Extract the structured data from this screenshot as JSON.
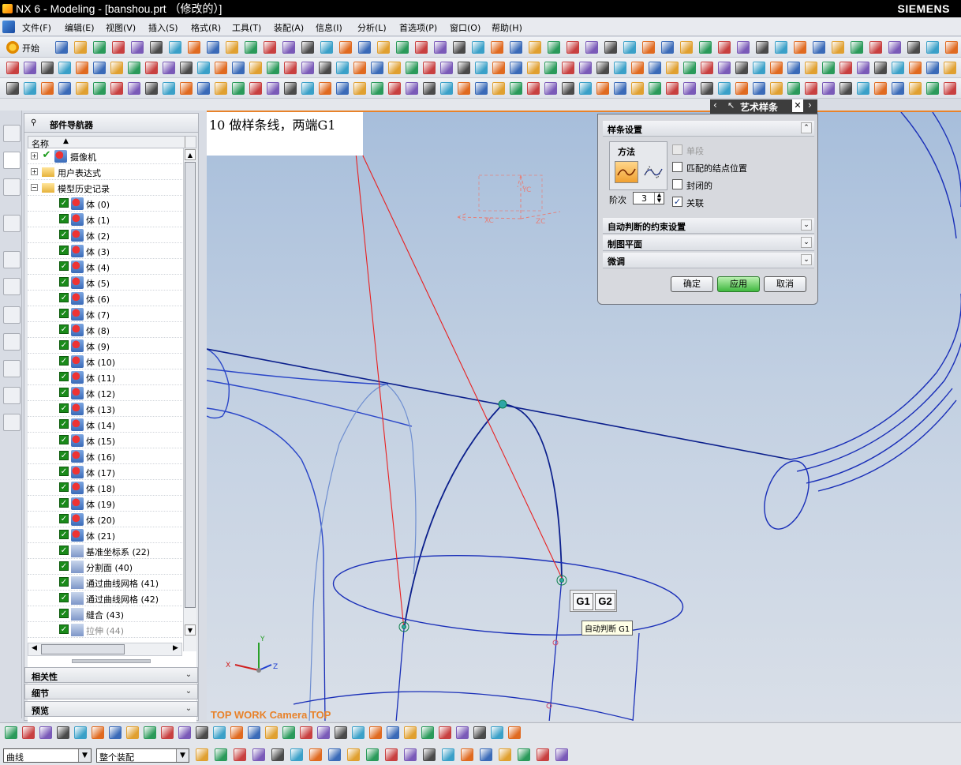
{
  "window": {
    "title": "NX 6 - Modeling - [banshou.prt （修改的）]",
    "brand": "SIEMENS"
  },
  "menu": [
    "文件(F)",
    "编辑(E)",
    "视图(V)",
    "插入(S)",
    "格式(R)",
    "工具(T)",
    "装配(A)",
    "信息(I)",
    "分析(L)",
    "首选项(P)",
    "窗口(O)",
    "帮助(H)"
  ],
  "toolbar": {
    "start_label": "开始"
  },
  "navigator": {
    "title": "部件导航器",
    "column_name": "名称",
    "top_items": [
      {
        "label": "摄像机",
        "expand": "+"
      },
      {
        "label": "用户表达式",
        "expand": "+"
      },
      {
        "label": "模型历史记录",
        "expand": "−"
      }
    ],
    "history_items": [
      {
        "label": "体 (0)"
      },
      {
        "label": "体 (1)"
      },
      {
        "label": "体 (2)"
      },
      {
        "label": "体 (3)"
      },
      {
        "label": "体 (4)"
      },
      {
        "label": "体 (5)"
      },
      {
        "label": "体 (6)"
      },
      {
        "label": "体 (7)"
      },
      {
        "label": "体 (8)"
      },
      {
        "label": "体 (9)"
      },
      {
        "label": "体 (10)"
      },
      {
        "label": "体 (11)"
      },
      {
        "label": "体 (12)"
      },
      {
        "label": "体 (13)"
      },
      {
        "label": "体 (14)"
      },
      {
        "label": "体 (15)"
      },
      {
        "label": "体 (16)"
      },
      {
        "label": "体 (17)"
      },
      {
        "label": "体 (18)"
      },
      {
        "label": "体 (19)"
      },
      {
        "label": "体 (20)"
      },
      {
        "label": "体 (21)"
      },
      {
        "label": "基准坐标系 (22)"
      },
      {
        "label": "分割面 (40)"
      },
      {
        "label": "通过曲线网格 (41)"
      },
      {
        "label": "通过曲线网格 (42)"
      },
      {
        "label": "缝合 (43)"
      },
      {
        "label": "拉伸 (44)"
      }
    ],
    "sections": [
      "相关性",
      "细节",
      "预览"
    ]
  },
  "viewport": {
    "note": "10 做样条线，两端G1",
    "view_label": "TOP WORK Camera TOP",
    "axis_labels": {
      "yc": "YC",
      "xc": "XC",
      "zc": "ZC",
      "x": "X",
      "y": "Y",
      "z": "Z"
    },
    "continuity_buttons": [
      "G1",
      "G2"
    ],
    "tooltip": "自动判断 G1"
  },
  "dialog": {
    "title": "艺术样条",
    "sections": {
      "spline_settings": "样条设置",
      "constraints": "自动判断的约束设置",
      "plane": "制图平面",
      "fine_tune": "微调"
    },
    "method_label": "方法",
    "degree_label": "阶次",
    "degree_value": "3",
    "options": [
      {
        "label": "单段",
        "checked": false,
        "disabled": true
      },
      {
        "label": "匹配的结点位置",
        "checked": false,
        "disabled": false
      },
      {
        "label": "封闭的",
        "checked": false,
        "disabled": false
      },
      {
        "label": "关联",
        "checked": true,
        "disabled": false
      }
    ],
    "buttons": {
      "ok": "确定",
      "apply": "应用",
      "cancel": "取消"
    }
  },
  "statusbar": {
    "filter": "曲线",
    "scope": "整个装配"
  },
  "colors": {
    "accent_orange": "#e8822a",
    "curve_blue": "#0b1f8c",
    "apply_green": "#3fb83f"
  }
}
